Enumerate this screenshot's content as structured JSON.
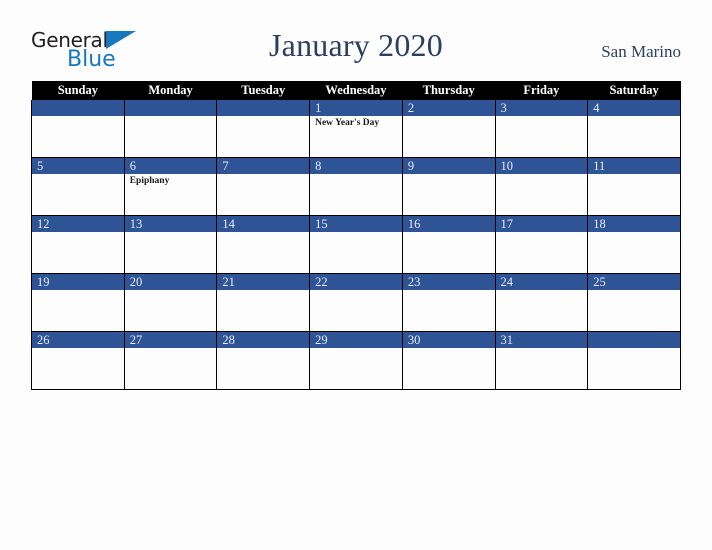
{
  "brand": {
    "name_part1": "General",
    "name_part2": "Blue",
    "triangle_icon": "blue-triangle-icon",
    "accent_color": "#1878be",
    "text_color": "#231f20"
  },
  "header": {
    "title": "January 2020",
    "region": "San Marino",
    "title_color": "#2b3f63"
  },
  "calendar": {
    "month": "January",
    "year": "2020",
    "header_bg": "#000000",
    "daynum_bg": "#2f5496",
    "cell_bg": "#fdfdfd",
    "weekday_headers": [
      "Sunday",
      "Monday",
      "Tuesday",
      "Wednesday",
      "Thursday",
      "Friday",
      "Saturday"
    ],
    "weeks": [
      [
        {
          "day": "",
          "events": []
        },
        {
          "day": "",
          "events": []
        },
        {
          "day": "",
          "events": []
        },
        {
          "day": "1",
          "events": [
            "New Year's Day"
          ]
        },
        {
          "day": "2",
          "events": []
        },
        {
          "day": "3",
          "events": []
        },
        {
          "day": "4",
          "events": []
        }
      ],
      [
        {
          "day": "5",
          "events": []
        },
        {
          "day": "6",
          "events": [
            "Epiphany"
          ]
        },
        {
          "day": "7",
          "events": []
        },
        {
          "day": "8",
          "events": []
        },
        {
          "day": "9",
          "events": []
        },
        {
          "day": "10",
          "events": []
        },
        {
          "day": "11",
          "events": []
        }
      ],
      [
        {
          "day": "12",
          "events": []
        },
        {
          "day": "13",
          "events": []
        },
        {
          "day": "14",
          "events": []
        },
        {
          "day": "15",
          "events": []
        },
        {
          "day": "16",
          "events": []
        },
        {
          "day": "17",
          "events": []
        },
        {
          "day": "18",
          "events": []
        }
      ],
      [
        {
          "day": "19",
          "events": []
        },
        {
          "day": "20",
          "events": []
        },
        {
          "day": "21",
          "events": []
        },
        {
          "day": "22",
          "events": []
        },
        {
          "day": "23",
          "events": []
        },
        {
          "day": "24",
          "events": []
        },
        {
          "day": "25",
          "events": []
        }
      ],
      [
        {
          "day": "26",
          "events": []
        },
        {
          "day": "27",
          "events": []
        },
        {
          "day": "28",
          "events": []
        },
        {
          "day": "29",
          "events": []
        },
        {
          "day": "30",
          "events": []
        },
        {
          "day": "31",
          "events": []
        },
        {
          "day": "",
          "events": []
        }
      ]
    ]
  }
}
